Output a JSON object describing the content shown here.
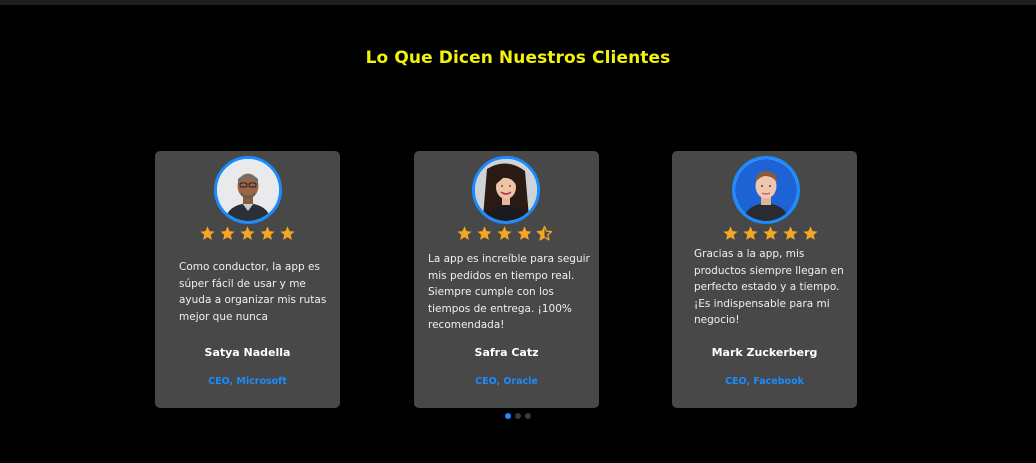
{
  "section": {
    "title": "Lo Que Dicen Nuestros Clientes"
  },
  "colors": {
    "background": "#000000",
    "card": "#484848",
    "title": "#f2f20a",
    "accent": "#1a8cff",
    "star": "#f5a623"
  },
  "testimonials": [
    {
      "quote": "Como conductor, la app es súper fácil de usar y me ayuda a organizar mis rutas mejor que nunca",
      "name": "Satya Nadella",
      "role": "CEO, Microsoft",
      "rating": 5,
      "avatar_icon": "portrait-photo"
    },
    {
      "quote": "La app es increíble para seguir mis pedidos en tiempo real. Siempre cumple con los tiempos de entrega. ¡100% recomendada!",
      "name": "Safra Catz",
      "role": "CEO, Oracle",
      "rating": 4.5,
      "avatar_icon": "portrait-photo"
    },
    {
      "quote": "Gracias a la app, mis productos siempre llegan en perfecto estado y a tiempo. ¡Es indispensable para mi negocio!",
      "name": "Mark Zuckerberg",
      "role": "CEO, Facebook",
      "rating": 5,
      "avatar_icon": "portrait-photo"
    }
  ],
  "carousel": {
    "slides": 3,
    "active_index": 0
  }
}
